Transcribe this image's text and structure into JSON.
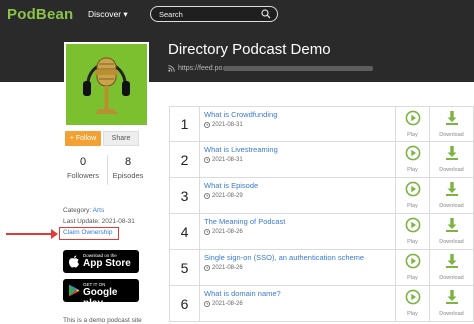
{
  "brand": {
    "logo_text": "PodBean",
    "accent": "#8bc34a"
  },
  "nav": {
    "discover_label": "Discover ▾"
  },
  "search": {
    "placeholder": "Search"
  },
  "podcast": {
    "title": "Directory Podcast Demo",
    "feed_prefix": "https://feed.po"
  },
  "actions": {
    "follow_label": "+ Follow",
    "share_label": "Share"
  },
  "stats": {
    "followers_count": "0",
    "followers_label": "Followers",
    "episodes_count": "8",
    "episodes_label": "Episodes"
  },
  "meta": {
    "category_prefix": "Category: ",
    "category_value": "Arts",
    "last_update": "Last Update: 2021-08-31",
    "claim_label": "Claim Ownership"
  },
  "stores": {
    "apple_small": "Download on the",
    "apple_big": "App Store",
    "google_small": "GET IT ON",
    "google_big": "Google play"
  },
  "description": "This is a demo podcast site",
  "episodes": [
    {
      "num": "1",
      "title": "What is Crowdfunding",
      "date": "2021-08-31",
      "play": "Play",
      "download": "Download"
    },
    {
      "num": "2",
      "title": "What is Livestreaming",
      "date": "2021-08-31",
      "play": "Play",
      "download": "Download"
    },
    {
      "num": "3",
      "title": "What is Episode",
      "date": "2021-08-29",
      "play": "Play",
      "download": "Download"
    },
    {
      "num": "4",
      "title": "The Meaning of Podcast",
      "date": "2021-08-26",
      "play": "Play",
      "download": "Download"
    },
    {
      "num": "5",
      "title": "Single sign-on (SSO), an authentication scheme",
      "date": "2021-08-26",
      "play": "Play",
      "download": "Download"
    },
    {
      "num": "6",
      "title": "What is domain name?",
      "date": "2021-08-26",
      "play": "Play",
      "download": "Download"
    }
  ]
}
